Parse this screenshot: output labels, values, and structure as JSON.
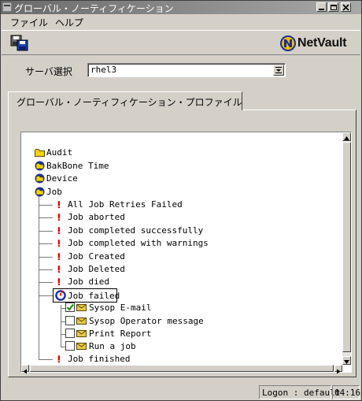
{
  "window": {
    "title": "グローバル・ノーティフィケーション"
  },
  "menu": [
    {
      "label": "ファイル"
    },
    {
      "label": "ヘルプ"
    }
  ],
  "logo": {
    "text": "NetVault"
  },
  "server": {
    "label": "サーバ選択",
    "value": "rhel3"
  },
  "tab": {
    "label": "グローバル・ノーティフィケーション・プロファイル"
  },
  "tree": {
    "nodes": [
      {
        "label": "Audit",
        "icon": "folder-icon"
      },
      {
        "label": "BakBone Time",
        "icon": "folder-open-icon"
      },
      {
        "label": "Device",
        "icon": "folder-open-icon"
      },
      {
        "label": "Job",
        "icon": "folder-open-icon"
      },
      {
        "label": "All Job Retries Failed",
        "icon": "exclamation-icon"
      },
      {
        "label": "Job aborted",
        "icon": "exclamation-icon"
      },
      {
        "label": "Job completed successfully",
        "icon": "exclamation-icon"
      },
      {
        "label": "Job completed with warnings",
        "icon": "exclamation-icon"
      },
      {
        "label": "Job Created",
        "icon": "exclamation-icon"
      },
      {
        "label": "Job Deleted",
        "icon": "exclamation-icon"
      },
      {
        "label": "Job died",
        "icon": "exclamation-icon"
      },
      {
        "label": "Job failed",
        "icon": "event-refresh-icon",
        "selected": true
      },
      {
        "label": "Sysop E-mail",
        "icon": "envelope-icon",
        "checked": true
      },
      {
        "label": "Sysop Operator message",
        "icon": "envelope-icon",
        "checked": false
      },
      {
        "label": "Print Report",
        "icon": "envelope-icon",
        "checked": false
      },
      {
        "label": "Run a job",
        "icon": "envelope-icon",
        "checked": false
      },
      {
        "label": "Job finished",
        "icon": "exclamation-icon"
      }
    ]
  },
  "status": {
    "logon": "Logon : default",
    "time": "04:16"
  },
  "colors": {
    "exclamation": "#e00000",
    "folder": "#f3d400",
    "check": "#0a8a0a",
    "envelope": "#e8c84a"
  }
}
